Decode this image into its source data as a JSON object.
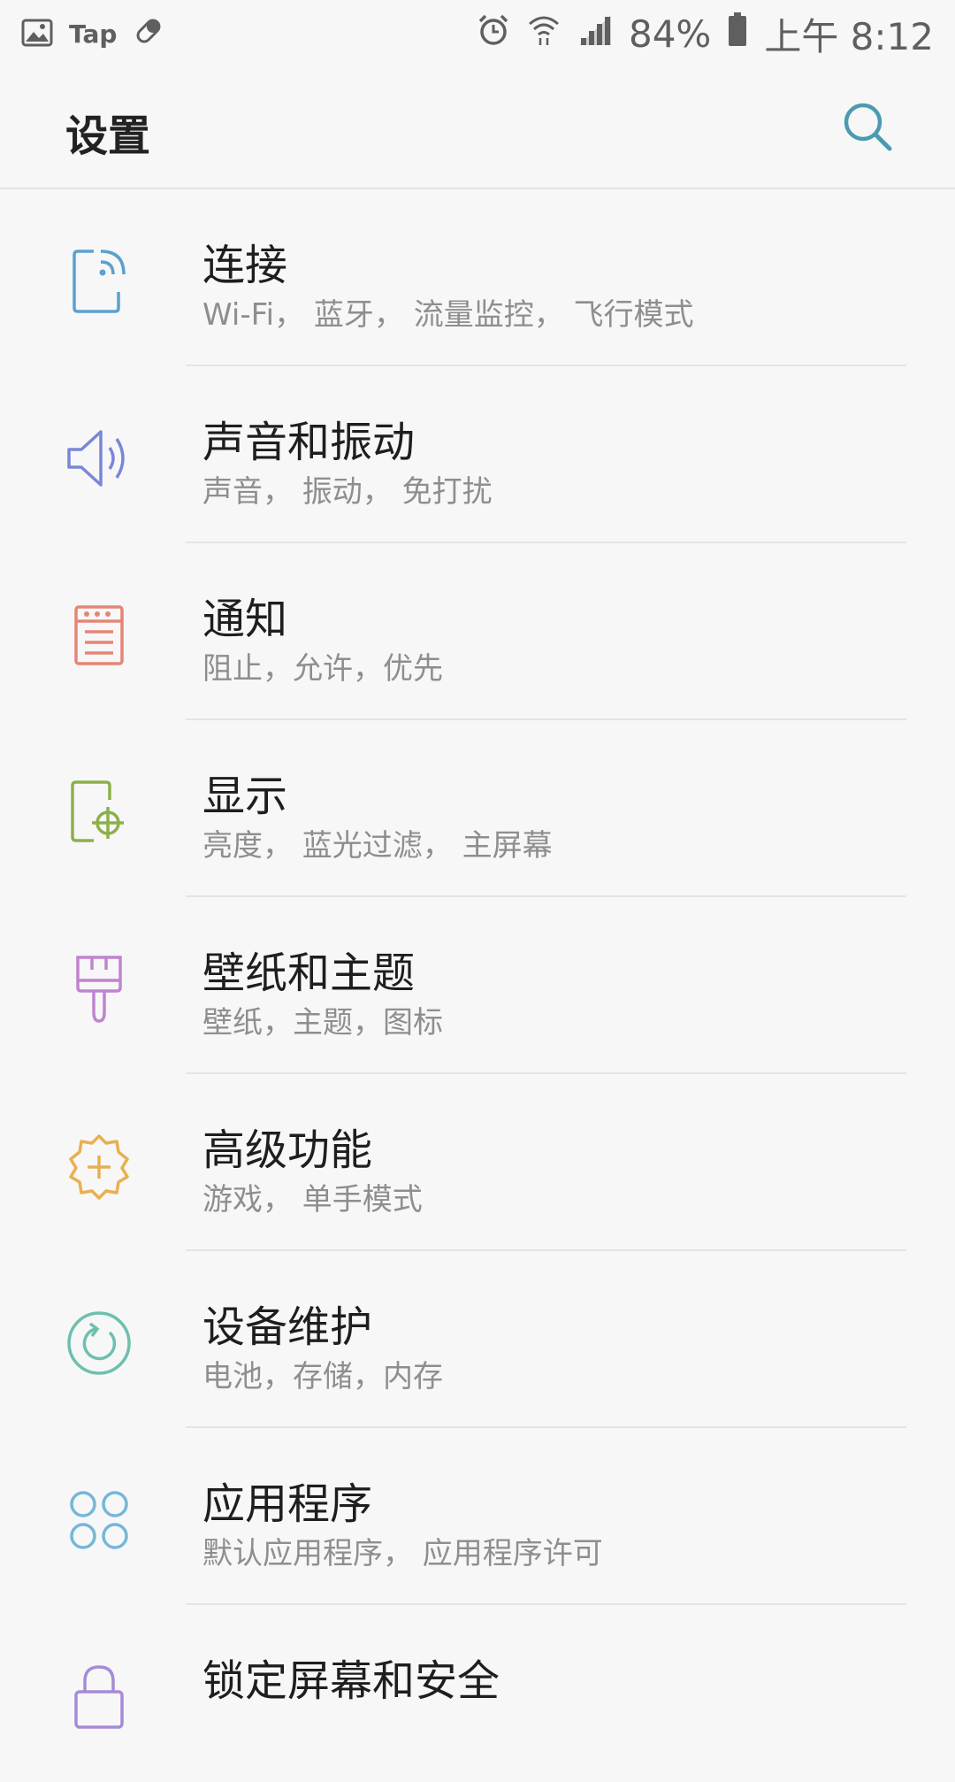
{
  "status_bar": {
    "app_label": "Tap",
    "battery": "84%",
    "time": "上午 8:12"
  },
  "header": {
    "title": "设置",
    "search_icon": "search-icon"
  },
  "colors": {
    "accent": "#4a9bb0",
    "connections": "#5aa1cf",
    "sound": "#7a87d6",
    "notifications": "#e58674",
    "display": "#8bb04a",
    "wallpaper": "#c084cf",
    "advanced": "#e9b04f",
    "maintenance": "#6ec0ad",
    "apps": "#74b7d8",
    "lock": "#a78bd6"
  },
  "settings": [
    {
      "title": "连接",
      "subtitle": "Wi-Fi， 蓝牙， 流量监控， 飞行模式",
      "icon": "connections-icon"
    },
    {
      "title": "声音和振动",
      "subtitle": "声音， 振动， 免打扰",
      "icon": "sound-icon"
    },
    {
      "title": "通知",
      "subtitle": "阻止，允许，优先",
      "icon": "notifications-icon"
    },
    {
      "title": "显示",
      "subtitle": "亮度， 蓝光过滤， 主屏幕",
      "icon": "display-icon"
    },
    {
      "title": "壁纸和主题",
      "subtitle": "壁纸，主题，图标",
      "icon": "brush-icon"
    },
    {
      "title": "高级功能",
      "subtitle": "游戏， 单手模式",
      "icon": "gear-plus-icon"
    },
    {
      "title": "设备维护",
      "subtitle": "电池，存储，内存",
      "icon": "refresh-icon"
    },
    {
      "title": "应用程序",
      "subtitle": "默认应用程序， 应用程序许可",
      "icon": "apps-icon"
    },
    {
      "title": "锁定屏幕和安全",
      "subtitle": "",
      "icon": "lock-icon"
    }
  ]
}
